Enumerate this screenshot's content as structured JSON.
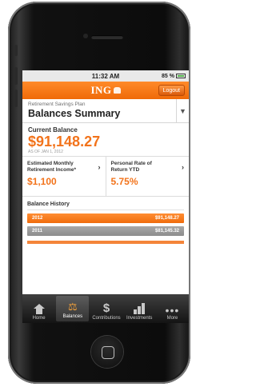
{
  "status_bar": {
    "time": "11:32 AM",
    "battery": "85 %"
  },
  "nav": {
    "logo": "ING",
    "logout_label": "Logout"
  },
  "plan_header": {
    "subtitle": "Retirement Savings Plan",
    "title": "Balances Summary"
  },
  "current_balance": {
    "label": "Current Balance",
    "amount": "$91,148.27",
    "as_of": "AS OF JAN 1, 2012"
  },
  "stats": [
    {
      "label": "Estimated Monthly Retirement Income*",
      "value": "$1,100"
    },
    {
      "label": "Personal Rate of Return YTD",
      "value": "5.75%"
    }
  ],
  "balance_history": {
    "title": "Balance History",
    "rows": [
      {
        "year": "2012",
        "amount": "$91,148.27",
        "color": "#f06c0c"
      },
      {
        "year": "2011",
        "amount": "$81,145.32",
        "color": "#8c8c8c"
      }
    ]
  },
  "tabs": [
    {
      "label": "Home",
      "icon": "home-icon",
      "active": false
    },
    {
      "label": "Balances",
      "icon": "scale-icon",
      "active": true
    },
    {
      "label": "Contributions",
      "icon": "dollar-icon",
      "active": false
    },
    {
      "label": "Investments",
      "icon": "bar-chart-icon",
      "active": false
    },
    {
      "label": "More",
      "icon": "more-dots-icon",
      "active": false
    }
  ],
  "colors": {
    "accent": "#f2731b",
    "navbar": "#ef6a08",
    "tabbar": "#141414"
  }
}
